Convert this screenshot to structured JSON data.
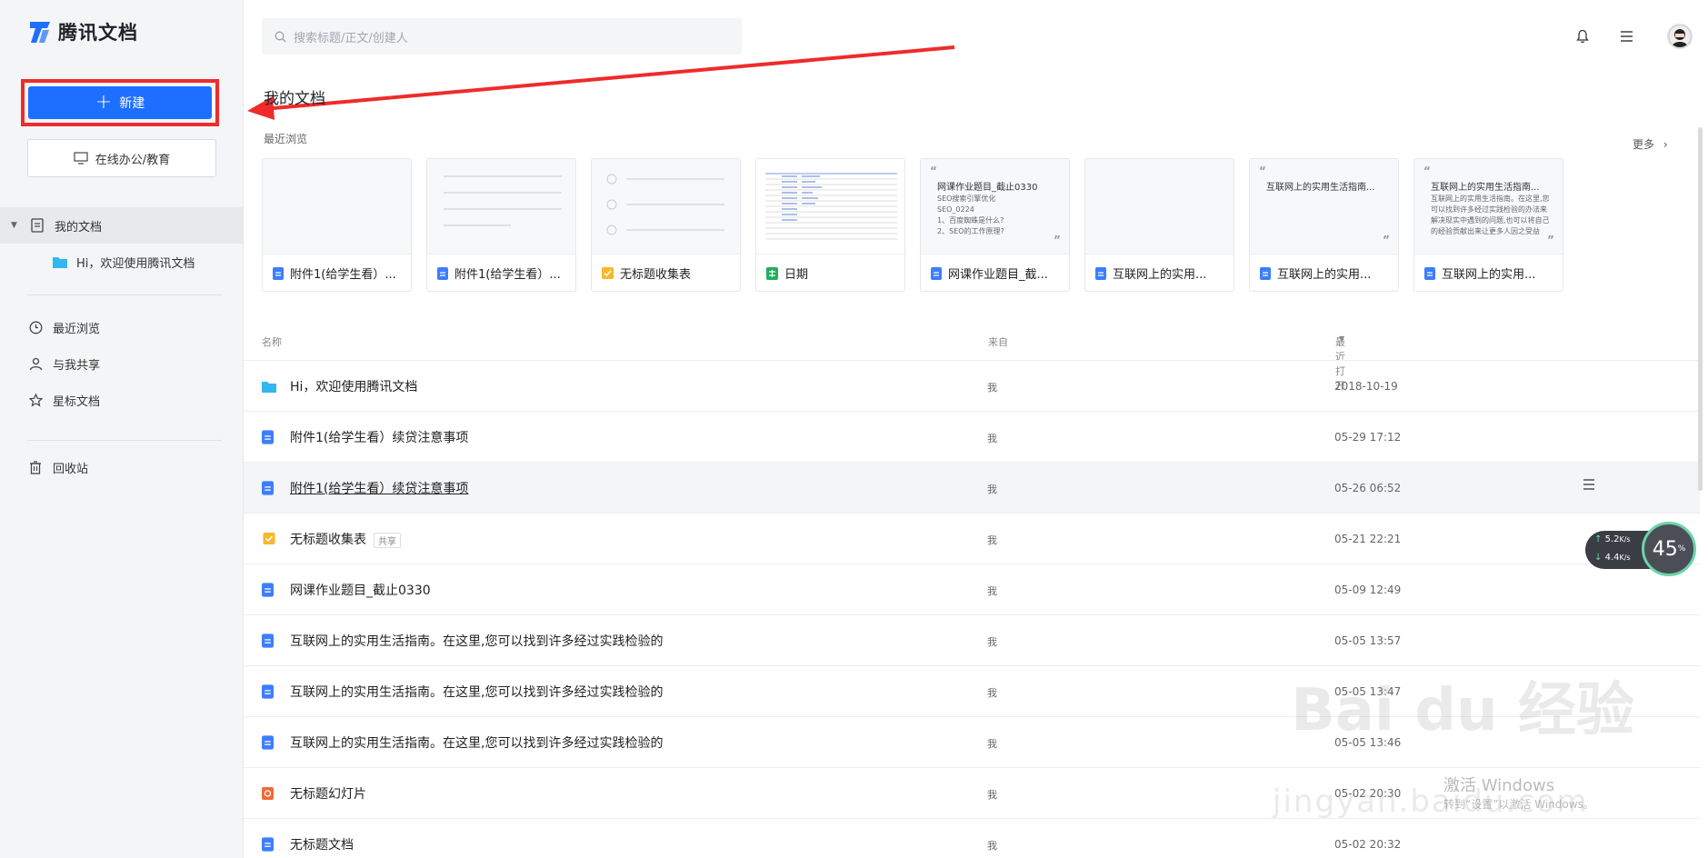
{
  "app": {
    "name": "腾讯文档"
  },
  "sidebar": {
    "new_label": "新建",
    "office_label": "在线办公/教育",
    "my_docs": "我的文档",
    "welcome_folder": "Hi，欢迎使用腾讯文档",
    "items": [
      {
        "label": "最近浏览",
        "icon": "clock-icon"
      },
      {
        "label": "与我共享",
        "icon": "user-icon"
      },
      {
        "label": "星标文档",
        "icon": "star-icon"
      },
      {
        "label": "回收站",
        "icon": "trash-icon"
      }
    ]
  },
  "search": {
    "placeholder": "搜索标题/正文/创建人"
  },
  "main": {
    "title": "我的文档",
    "recent_label": "最近浏览",
    "more_label": "更多",
    "recent_cards": [
      {
        "title": "附件1(给学生看）...",
        "type": "doc"
      },
      {
        "title": "附件1(给学生看）...",
        "type": "doc"
      },
      {
        "title": "无标题收集表",
        "type": "form"
      },
      {
        "title": "日期",
        "type": "sheet"
      },
      {
        "title": "网课作业题目_截...",
        "type": "doc",
        "preview_title": "网课作业题目_截止0330",
        "preview_body": "SEO搜索引擎优化\nSEO_0224\n1、百度蜘蛛是什么?\n2、SEO的工作原理?"
      },
      {
        "title": "互联网上的实用...",
        "type": "doc"
      },
      {
        "title": "互联网上的实用...",
        "type": "doc",
        "preview_title": "互联网上的实用生活指南..."
      },
      {
        "title": "互联网上的实用...",
        "type": "doc",
        "preview_title": "互联网上的实用生活指南...",
        "preview_body": "互联网上的实用生活指南。在这里,您可以找到许多经过实践检验的办法来解决现实中遇到的问题,也可以将自己的经验贡献出来让更多人因之受益"
      }
    ],
    "columns": {
      "name": "名称",
      "from": "来自",
      "opened": "最近打开"
    },
    "files": [
      {
        "name": "Hi，欢迎使用腾讯文档",
        "type": "folder",
        "from": "我",
        "time": "2018-10-19"
      },
      {
        "name": "附件1(给学生看）续贷注意事项",
        "type": "doc",
        "from": "我",
        "time": "05-29 17:12"
      },
      {
        "name": "附件1(给学生看）续贷注意事项",
        "type": "doc",
        "from": "我",
        "time": "05-26 06:52",
        "hover": true
      },
      {
        "name": "无标题收集表",
        "type": "form",
        "from": "我",
        "time": "05-21 22:21",
        "tag": "共享"
      },
      {
        "name": "网课作业题目_截止0330",
        "type": "doc",
        "from": "我",
        "time": "05-09 12:49"
      },
      {
        "name": "互联网上的实用生活指南。在这里,您可以找到许多经过实践检验的",
        "type": "doc",
        "from": "我",
        "time": "05-05 13:57"
      },
      {
        "name": "互联网上的实用生活指南。在这里,您可以找到许多经过实践检验的",
        "type": "doc",
        "from": "我",
        "time": "05-05 13:47"
      },
      {
        "name": "互联网上的实用生活指南。在这里,您可以找到许多经过实践检验的",
        "type": "doc",
        "from": "我",
        "time": "05-05 13:46"
      },
      {
        "name": "无标题幻灯片",
        "type": "slide",
        "from": "我",
        "time": "05-02 20:30"
      },
      {
        "name": "无标题文档",
        "type": "doc",
        "from": "我",
        "time": "05-02 20:32"
      }
    ]
  },
  "overlay": {
    "speed_up": "5.2",
    "speed_down": "4.4",
    "speed_unit": "K/s",
    "percent": "45",
    "percent_unit": "%",
    "watermark": "Bai du 经验",
    "watermark_url": "jingyan.baidu.com",
    "windows_activate": "激活 Windows",
    "windows_activate_sub": "转到“设置”以激活 Windows。"
  },
  "colors": {
    "accent": "#1e6fff",
    "highlight": "#ef2b2b",
    "doc": "#3c7eff",
    "form": "#f5b82e",
    "sheet": "#1fae5c",
    "slide": "#f06a3a",
    "folder": "#33b7f0"
  }
}
